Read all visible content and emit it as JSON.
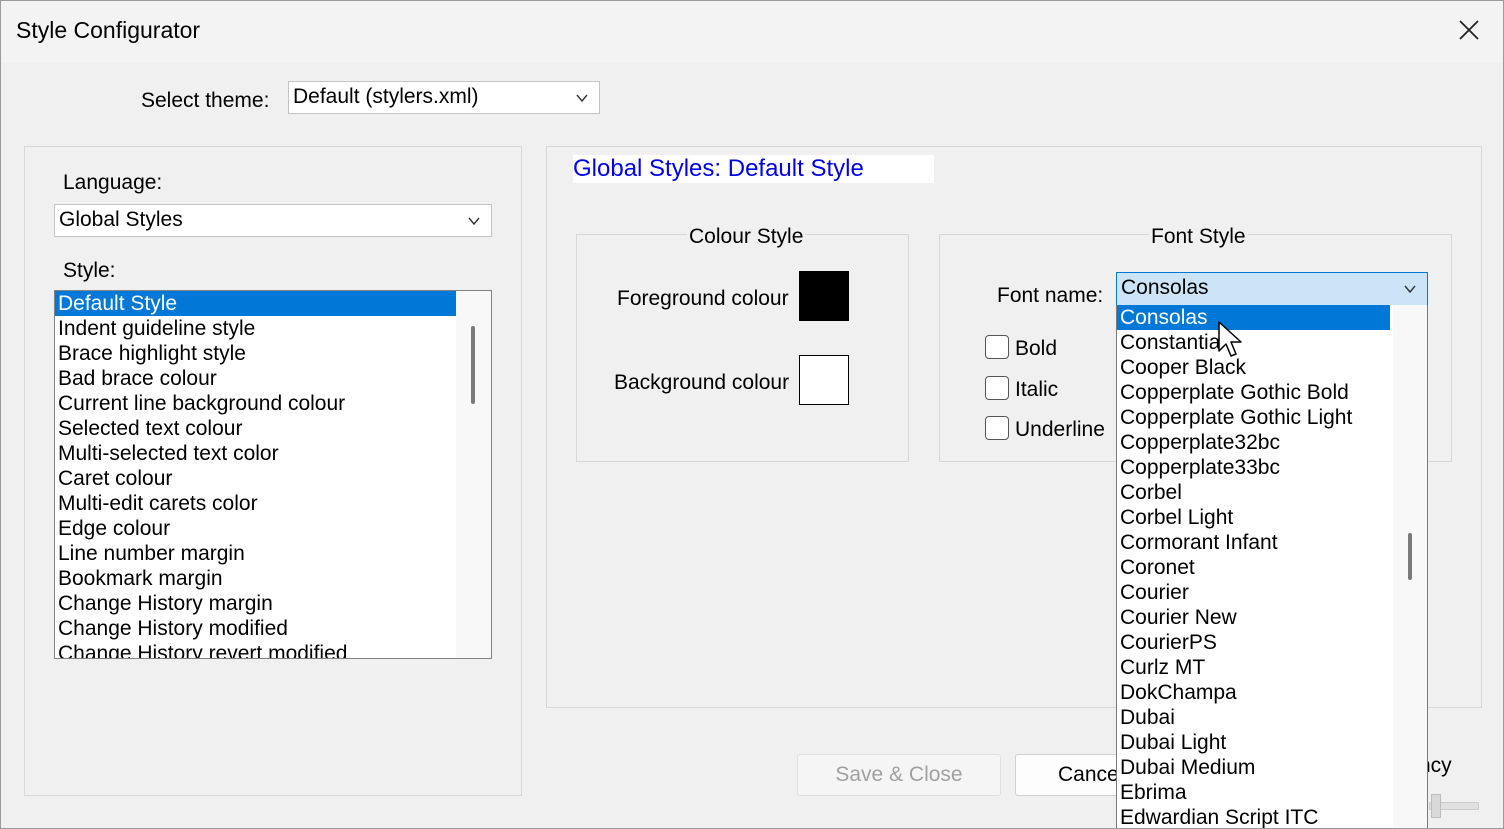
{
  "window": {
    "title": "Style Configurator"
  },
  "theme": {
    "label": "Select theme:",
    "value": "Default (stylers.xml)"
  },
  "language": {
    "label": "Language:",
    "value": "Global Styles"
  },
  "style": {
    "label": "Style:",
    "selected_index": 0,
    "items": [
      "Default Style",
      "Indent guideline style",
      "Brace highlight style",
      "Bad brace colour",
      "Current line background colour",
      "Selected text colour",
      "Multi-selected text color",
      "Caret colour",
      "Multi-edit carets color",
      "Edge colour",
      "Line number margin",
      "Bookmark margin",
      "Change History margin",
      "Change History modified",
      "Change History revert modified"
    ]
  },
  "style_title": "Global Styles: Default Style",
  "colour_style": {
    "group_label": "Colour Style",
    "foreground_label": "Foreground colour",
    "foreground_color": "#000000",
    "background_label": "Background colour",
    "background_color": "#ffffff"
  },
  "font_style": {
    "group_label": "Font Style",
    "font_name_label": "Font name:",
    "font_name_value": "Consolas",
    "bold_label": "Bold",
    "italic_label": "Italic",
    "underline_label": "Underline",
    "bold_checked": false,
    "italic_checked": false,
    "underline_checked": false
  },
  "font_dropdown": {
    "selected_index": 0,
    "options": [
      "Consolas",
      "Constantia",
      "Cooper Black",
      "Copperplate Gothic Bold",
      "Copperplate Gothic Light",
      "Copperplate32bc",
      "Copperplate33bc",
      "Corbel",
      "Corbel Light",
      "Cormorant Infant",
      "Coronet",
      "Courier",
      "Courier New",
      "CourierPS",
      "Curlz MT",
      "DokChampa",
      "Dubai",
      "Dubai Light",
      "Dubai Medium",
      "Ebrima",
      "Edwardian Script ITC"
    ]
  },
  "buttons": {
    "save_close": "Save & Close",
    "cancel": "Cancel",
    "transparency_partial": "ncy"
  },
  "colors": {
    "selection": "#0078d7",
    "title_link": "#0000ee"
  }
}
